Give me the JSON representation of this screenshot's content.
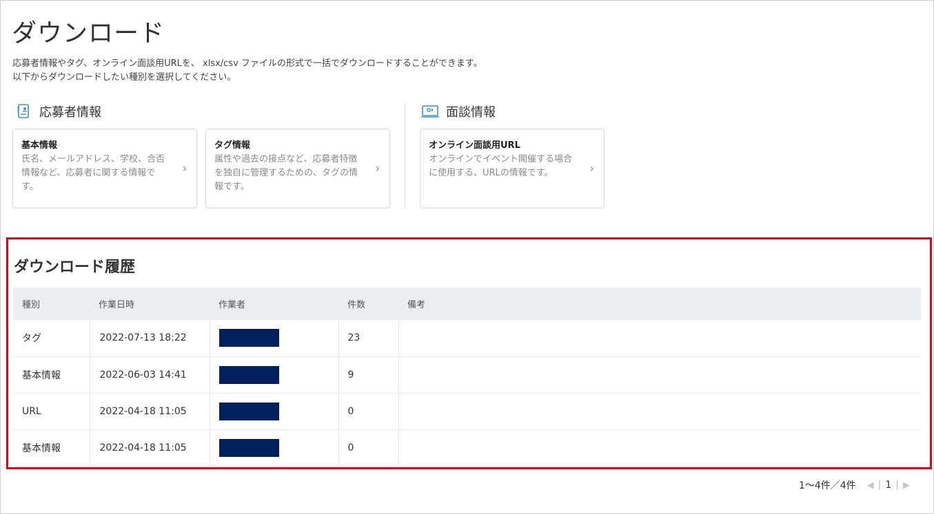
{
  "page": {
    "title": "ダウンロード",
    "description_line1": "応募者情報やタグ、オンライン面談用URLを、 xlsx/csv ファイルの形式で一括でダウンロードすることができます。",
    "description_line2": "以下からダウンロードしたい種別を選択してください。"
  },
  "sections": {
    "applicant": {
      "title": "応募者情報",
      "icon": "applicant-document-icon",
      "cards": [
        {
          "title": "基本情報",
          "body": "氏名、メールアドレス、学校、合否情報など、応募者に関する情報です。"
        },
        {
          "title": "タグ情報",
          "body": "属性や過去の接点など、応募者特徴を独自に管理するための、タグの情報です。"
        }
      ]
    },
    "interview": {
      "title": "面談情報",
      "icon": "video-interview-icon",
      "cards": [
        {
          "title": "オンライン面談用URL",
          "body": "オンラインでイベント開催する場合に使用する、URLの情報です。"
        }
      ]
    }
  },
  "history": {
    "title": "ダウンロード履歴",
    "columns": [
      "種別",
      "作業日時",
      "作業者",
      "件数",
      "備考"
    ],
    "rows": [
      {
        "type": "タグ",
        "datetime": "2022-07-13 18:22",
        "count": "23",
        "note": ""
      },
      {
        "type": "基本情報",
        "datetime": "2022-06-03 14:41",
        "count": "9",
        "note": ""
      },
      {
        "type": "URL",
        "datetime": "2022-04-18 11:05",
        "count": "0",
        "note": ""
      },
      {
        "type": "基本情報",
        "datetime": "2022-04-18 11:05",
        "count": "0",
        "note": ""
      }
    ],
    "highlight_color": "#e60012",
    "redaction_color": "#002060"
  },
  "pagination": {
    "range": "1〜4件／4件",
    "current_page": "1"
  }
}
